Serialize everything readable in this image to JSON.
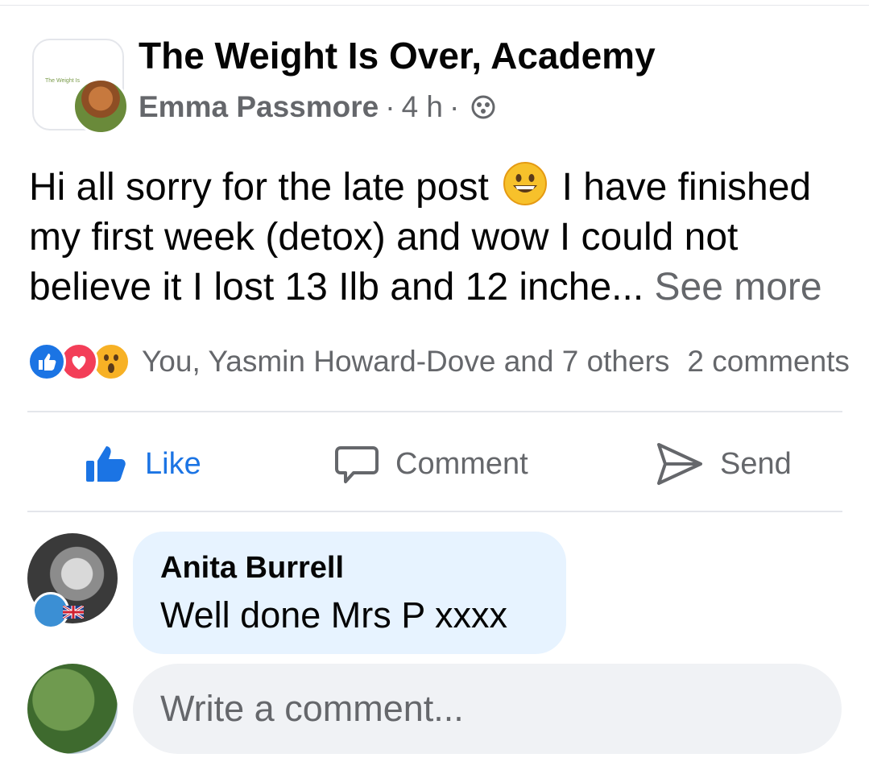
{
  "post": {
    "group_name": "The Weight Is Over, Academy",
    "group_logo_text": "The Weight Is",
    "author": "Emma Passmore",
    "separator1": "·",
    "time": "4 h",
    "separator2": "·",
    "text_before_emoji": "Hi all sorry for the late post",
    "text_after_emoji": " I have finished my first week (detox) and wow I could not believe it I lost 13 Ilb and 12 inche...",
    "see_more": "See more",
    "reactions_text": "You, Yasmin Howard-Dove and 7 others",
    "comments_count": "2 comments"
  },
  "actions": {
    "like": "Like",
    "comment": "Comment",
    "send": "Send"
  },
  "comment": {
    "author": "Anita Burrell",
    "text": "Well done Mrs P xxxx"
  },
  "compose": {
    "placeholder": "Write a comment..."
  },
  "colors": {
    "like_blue": "#1b74e4",
    "love_red": "#f33e58",
    "wow_yellow": "#f7b125",
    "bubble_bg": "#e7f3ff",
    "input_bg": "#f0f2f5"
  }
}
